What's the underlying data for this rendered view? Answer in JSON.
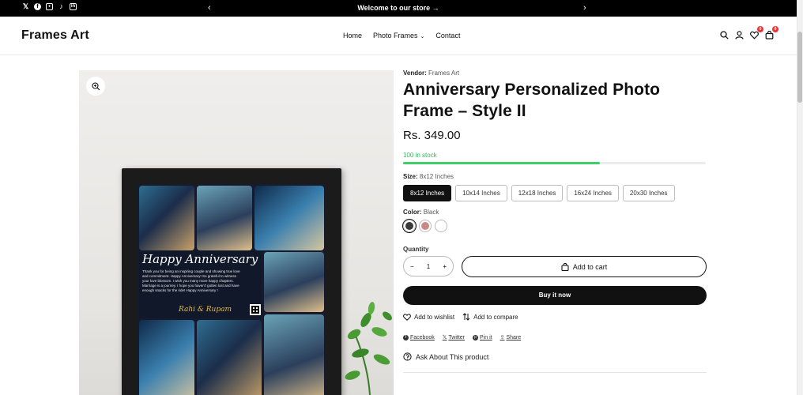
{
  "announcement": {
    "text": "Welcome to our store →",
    "prev_icon": "chevron-left-icon",
    "next_icon": "chevron-right-icon",
    "social": [
      "x-icon",
      "facebook-icon",
      "instagram-icon",
      "tiktok-icon",
      "linkedin-icon"
    ]
  },
  "header": {
    "logo": "Frames Art",
    "nav": [
      {
        "label": "Home"
      },
      {
        "label": "Photo Frames"
      },
      {
        "label": "Contact"
      }
    ],
    "wishlist_count": "0",
    "cart_count": "0"
  },
  "gallery": {
    "message_title": "Happy Anniversary",
    "message_body": "Thank you for being an inspiring couple and showing true love and commitment. Happy Anniversary! So grateful to witness your love blossom. I wish you many more happy chapters. Marriage is a journey. I hope you haven't gotten lost and have enough snacks for the ride! Happy Anniversary !",
    "signature": "Rahi & Rupam"
  },
  "product": {
    "vendor_label": "Vendor:",
    "vendor": "Frames Art",
    "title": "Anniversary Personalized Photo Frame – Style II",
    "price": "Rs. 349.00",
    "stock_text": "100 in stock",
    "stock_fraction": 0.65,
    "size_label": "Size:",
    "size_selected": "8x12 Inches",
    "sizes": [
      "8x12 Inches",
      "10x14 Inches",
      "12x18 Inches",
      "16x24 Inches",
      "20x30 Inches"
    ],
    "color_label": "Color:",
    "color_selected": "Black",
    "colors": [
      "#3a3a3a",
      "#c98a86",
      "#ffffff"
    ],
    "quantity_label": "Quantity",
    "quantity": "1",
    "qty_minus": "−",
    "qty_plus": "+",
    "add_to_cart": "Add to cart",
    "buy_now": "Buy it now",
    "wishlist": "Add to wishlist",
    "compare": "Add to compare",
    "share": [
      "Facebook",
      "Twitter",
      "Pin it",
      "Share"
    ],
    "ask": "Ask About This product"
  }
}
